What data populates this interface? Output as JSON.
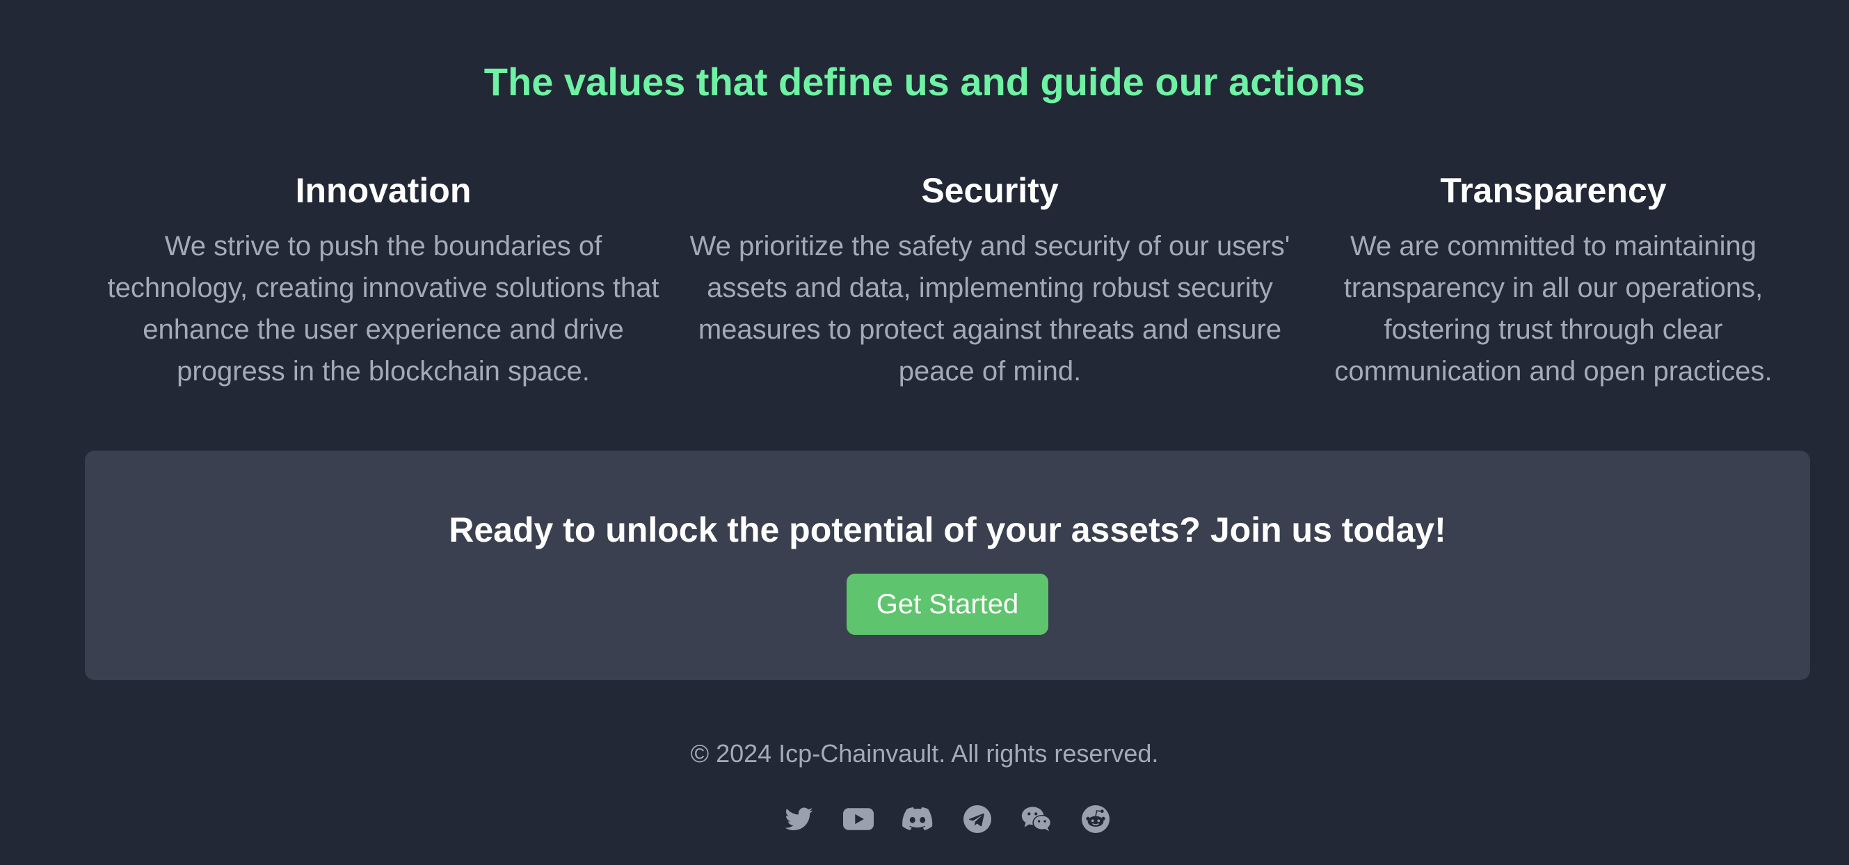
{
  "values_section": {
    "title": "The values that define us and guide our actions",
    "items": [
      {
        "heading": "Innovation",
        "text": "We strive to push the boundaries of technology, creating innovative solutions that enhance the user experience and drive progress in the blockchain space."
      },
      {
        "heading": "Security",
        "text": "We prioritize the safety and security of our users' assets and data, implementing robust security measures to protect against threats and ensure peace of mind."
      },
      {
        "heading": "Transparency",
        "text": "We are committed to maintaining transparency in all our operations, fostering trust through clear communication and open practices."
      }
    ]
  },
  "cta": {
    "heading": "Ready to unlock the potential of your assets? Join us today!",
    "button_label": "Get Started"
  },
  "footer": {
    "copyright": "© 2024 Icp-Chainvault. All rights reserved.",
    "social_icons": [
      "twitter-icon",
      "youtube-icon",
      "discord-icon",
      "telegram-icon",
      "wechat-icon",
      "reddit-icon"
    ]
  },
  "colors": {
    "background": "#222836",
    "accent_title": "#6ef2a3",
    "cta_panel": "#3a404f",
    "button": "#5ec46d",
    "muted_text": "#a4abb8"
  }
}
